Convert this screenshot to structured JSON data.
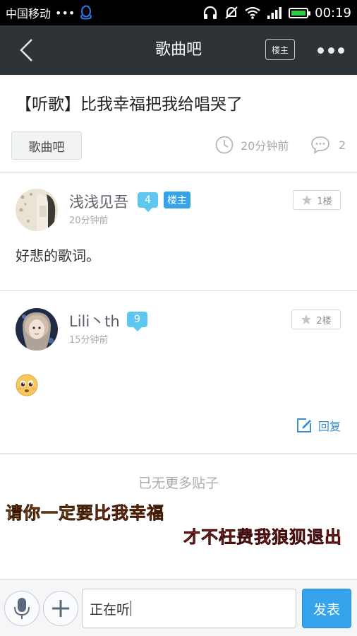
{
  "status_bar": {
    "carrier": "中国移动",
    "dots": "•••",
    "time": "00:19"
  },
  "nav": {
    "title": "歌曲吧",
    "owner_filter_label": "楼主"
  },
  "thread": {
    "title": "【听歌】比我幸福把我给唱哭了",
    "forum_tag": "歌曲吧",
    "time": "20分钟前",
    "reply_count": "2"
  },
  "posts": [
    {
      "username": "浅浅见吾",
      "level": "4",
      "owner_tag": "楼主",
      "time": "20分钟前",
      "floor": "1楼",
      "content": "好悲的歌词。"
    },
    {
      "username": "Lili丶th",
      "level": "9",
      "time": "15分钟前",
      "floor": "2楼",
      "content_emoji": "pleading-face-emoji",
      "reply_label": "回复"
    }
  ],
  "no_more_text": "已无更多贴子",
  "overlay": {
    "line1_part1": "请你一定",
    "line1_part2": "要比我幸福",
    "line2": "才不枉费我狼狈退出"
  },
  "input_bar": {
    "input_value": "正在听",
    "send_label": "发表"
  },
  "colors": {
    "nav_bg": "#2e3338",
    "accent_blue": "#36a4ec",
    "level_badge": "#5ec7ef",
    "owner_tag": "#35a3e8"
  }
}
